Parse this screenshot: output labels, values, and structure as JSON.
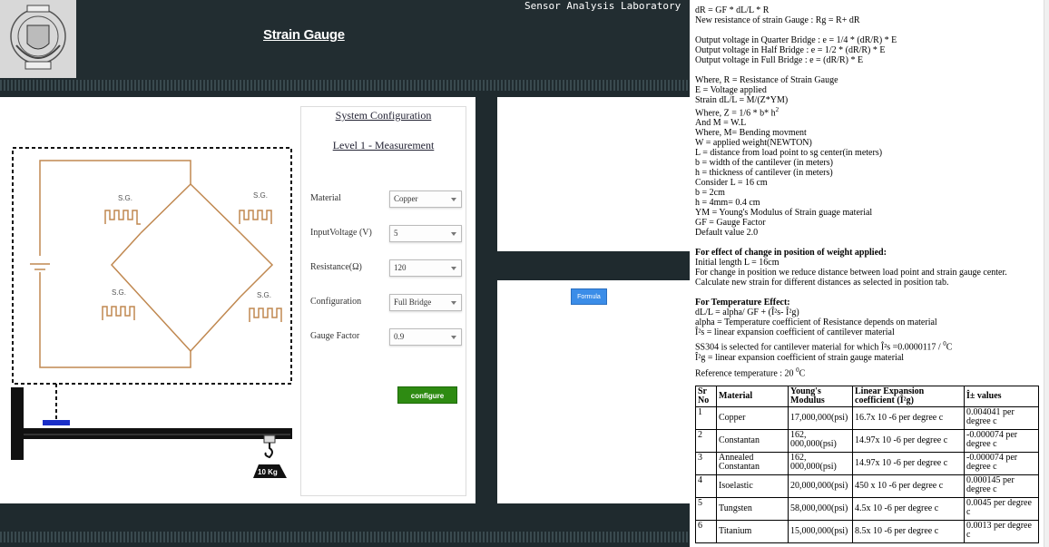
{
  "header": {
    "title": "Strain Gauge",
    "lab_title": "Sensor Analysis Laboratory"
  },
  "circuit": {
    "gauge_labels": [
      "S.G.",
      "S.G.",
      "S.G.",
      "S.G."
    ],
    "weight_label": "10 Kg"
  },
  "config": {
    "title": "System Configuration",
    "level": "Level 1 - Measurement",
    "fields": [
      {
        "label": "Material",
        "value": "Copper"
      },
      {
        "label": "InputVoltage (V)",
        "value": "5"
      },
      {
        "label": "Resistance(Ω)",
        "value": "120"
      },
      {
        "label": "Configuration",
        "value": "Full Bridge"
      },
      {
        "label": "Gauge Factor",
        "value": "0.9"
      }
    ],
    "configure_button": "configure"
  },
  "formula_button": "Formula",
  "formulas": {
    "lines_a": [
      "dR = GF * dL/L * R",
      "New resistance of strain Gauge : Rg = R+ dR"
    ],
    "lines_b": [
      "Output voltage in Quarter Bridge : e = 1/4 * (dR/R) * E",
      "Output voltage in Half Bridge : e = 1/2 * (dR/R) * E",
      "Output voltage in Full Bridge : e = (dR/R) * E"
    ],
    "lines_c": [
      "Where, R = Resistance of Strain Gauge",
      "E = Voltage applied",
      "Strain dL/L = M/(Z*YM)",
      "Where, Z = 1/6 * b* h",
      "And M = W.L",
      "Where, M= Bending movment",
      "W = applied weight(NEWTON)",
      "L = distance from load point to sg center(in meters)",
      "b = width of the cantilever (in meters)",
      "h = thickness of cantilever (in meters)",
      "Consider L = 16 cm",
      "b = 2cm",
      "h = 4mm= 0.4 cm",
      "YM = Young's Modulus of Strain guage material",
      "GF = Gauge Factor",
      "Default value 2.0"
    ],
    "z_superscript": "2",
    "position_heading": "For effect of change in position of weight applied:",
    "lines_d": [
      "Initial length L = 16cm",
      "For change in position we reduce distance between load point and strain gauge center.",
      "Calculate new strain for different distances as selected in position tab."
    ],
    "temperature_heading": "For Temperature Effect:",
    "lines_e": [
      "dL/L = alpha/ GF + (Î²s- Î²g)",
      "alpha = Temperature coefficient of Resistance depends on material",
      "Î²s = linear expansion coefficient of cantilever material"
    ],
    "ss304_line": "SS304 is selected for cantilever material for which Î²s =0.0000117 /",
    "ss304_sup": "0",
    "ss304_unit": "C",
    "beta_g_line": "Î²g = linear expansion coefficient of strain gauge material",
    "ref_temp_prefix": "Reference temperature : 20",
    "ref_temp_sup": "0",
    "ref_temp_unit": "C"
  },
  "material_table": {
    "headers": [
      "Sr No",
      "Material",
      "Young's Modulus",
      "Linear Expansion coefficient (Î²g)",
      "Î± values"
    ],
    "rows": [
      [
        "1",
        "Copper",
        "17,000,000(psi)",
        "16.7x 10 -6 per degree c",
        "0.004041 per degree c"
      ],
      [
        "2",
        "Constantan",
        "162, 000,000(psi)",
        "14.97x 10 -6 per degree c",
        "-0.000074 per degree c"
      ],
      [
        "3",
        "Annealed Constantan",
        "162, 000,000(psi)",
        "14.97x 10 -6 per degree c",
        "-0.000074 per degree c"
      ],
      [
        "4",
        "Isoelastic",
        "20,000,000(psi)",
        "450 x 10 -6 per degree c",
        "0.000145 per degree c"
      ],
      [
        "5",
        "Tungsten",
        "58,000,000(psi)",
        "4.5x 10 -6 per degree c",
        "0.0045 per degree c"
      ],
      [
        "6",
        "Titanium",
        "15,000,000(psi)",
        "8.5x 10 -6 per degree c",
        "0.0013 per degree c"
      ]
    ]
  },
  "colors": {
    "background": "#1f2a2e",
    "wire": "#c08850",
    "configure_button": "#2e8b12",
    "formula_button": "#3b8de8",
    "marker": "#1a2fc8"
  }
}
